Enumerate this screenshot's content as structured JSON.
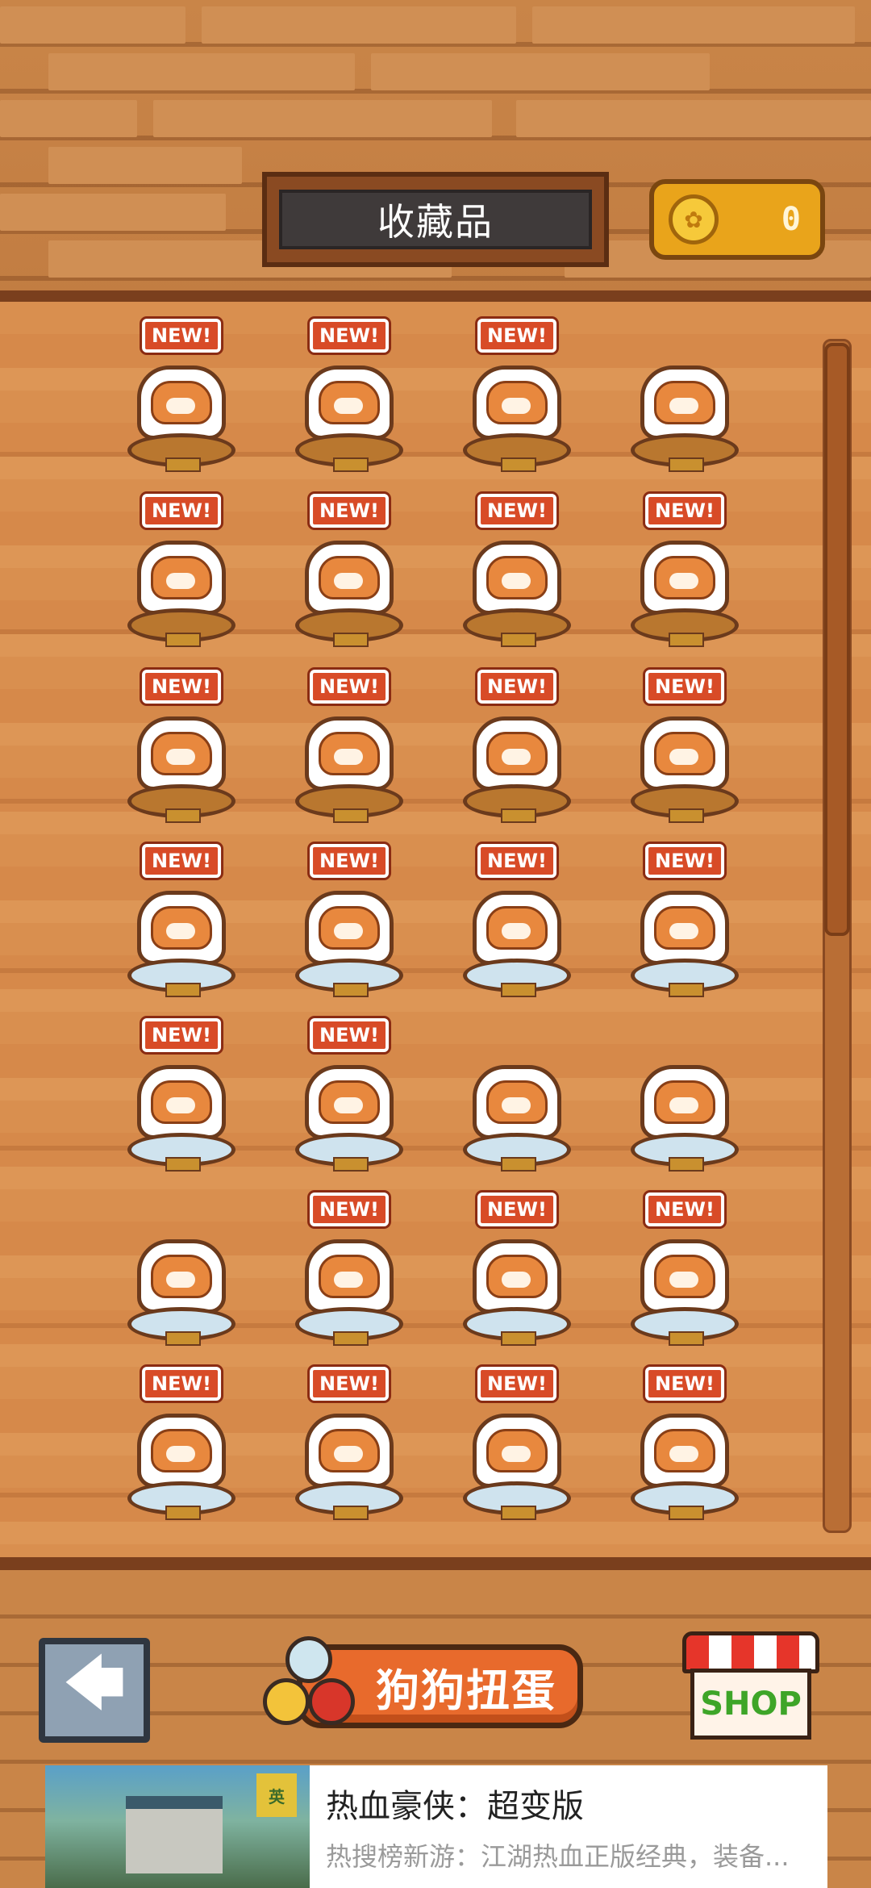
{
  "header": {
    "title": "收藏品",
    "coin_count": "0",
    "coin_icon": "paw-coin-icon"
  },
  "collection": {
    "items": [
      {
        "new": true,
        "badge": "NEW!",
        "base": "wood"
      },
      {
        "new": true,
        "badge": "NEW!",
        "base": "wood"
      },
      {
        "new": true,
        "badge": "NEW!",
        "base": "wood"
      },
      {
        "new": false,
        "badge": "",
        "base": "wood"
      },
      {
        "new": true,
        "badge": "NEW!",
        "base": "wood"
      },
      {
        "new": true,
        "badge": "NEW!",
        "base": "wood"
      },
      {
        "new": true,
        "badge": "NEW!",
        "base": "wood"
      },
      {
        "new": true,
        "badge": "NEW!",
        "base": "wood"
      },
      {
        "new": true,
        "badge": "NEW!",
        "base": "wood"
      },
      {
        "new": true,
        "badge": "NEW!",
        "base": "wood"
      },
      {
        "new": true,
        "badge": "NEW!",
        "base": "wood"
      },
      {
        "new": true,
        "badge": "NEW!",
        "base": "wood"
      },
      {
        "new": true,
        "badge": "NEW!",
        "base": "blue"
      },
      {
        "new": true,
        "badge": "NEW!",
        "base": "blue"
      },
      {
        "new": true,
        "badge": "NEW!",
        "base": "blue"
      },
      {
        "new": true,
        "badge": "NEW!",
        "base": "blue"
      },
      {
        "new": true,
        "badge": "NEW!",
        "base": "blue"
      },
      {
        "new": true,
        "badge": "NEW!",
        "base": "blue"
      },
      {
        "new": false,
        "badge": "",
        "base": "blue"
      },
      {
        "new": false,
        "badge": "",
        "base": "blue"
      },
      {
        "new": false,
        "badge": "",
        "base": "blue"
      },
      {
        "new": true,
        "badge": "NEW!",
        "base": "blue"
      },
      {
        "new": true,
        "badge": "NEW!",
        "base": "blue"
      },
      {
        "new": true,
        "badge": "NEW!",
        "base": "blue"
      },
      {
        "new": true,
        "badge": "NEW!",
        "base": "blue"
      },
      {
        "new": true,
        "badge": "NEW!",
        "base": "blue"
      },
      {
        "new": true,
        "badge": "NEW!",
        "base": "blue"
      },
      {
        "new": true,
        "badge": "NEW!",
        "base": "blue"
      }
    ]
  },
  "controls": {
    "back_icon": "arrow-left-icon",
    "gacha_label": "狗狗扭蛋",
    "shop_label": "SHOP"
  },
  "ad": {
    "title": "热血豪侠：超变版",
    "description": "热搜榜新游：江湖热血正版经典，装备...",
    "badge": "英"
  },
  "colors": {
    "new_badge": "#d84b27",
    "gacha_button": "#e86a2c",
    "shop_text": "#3ea528",
    "coin_box": "#e9a41b"
  }
}
